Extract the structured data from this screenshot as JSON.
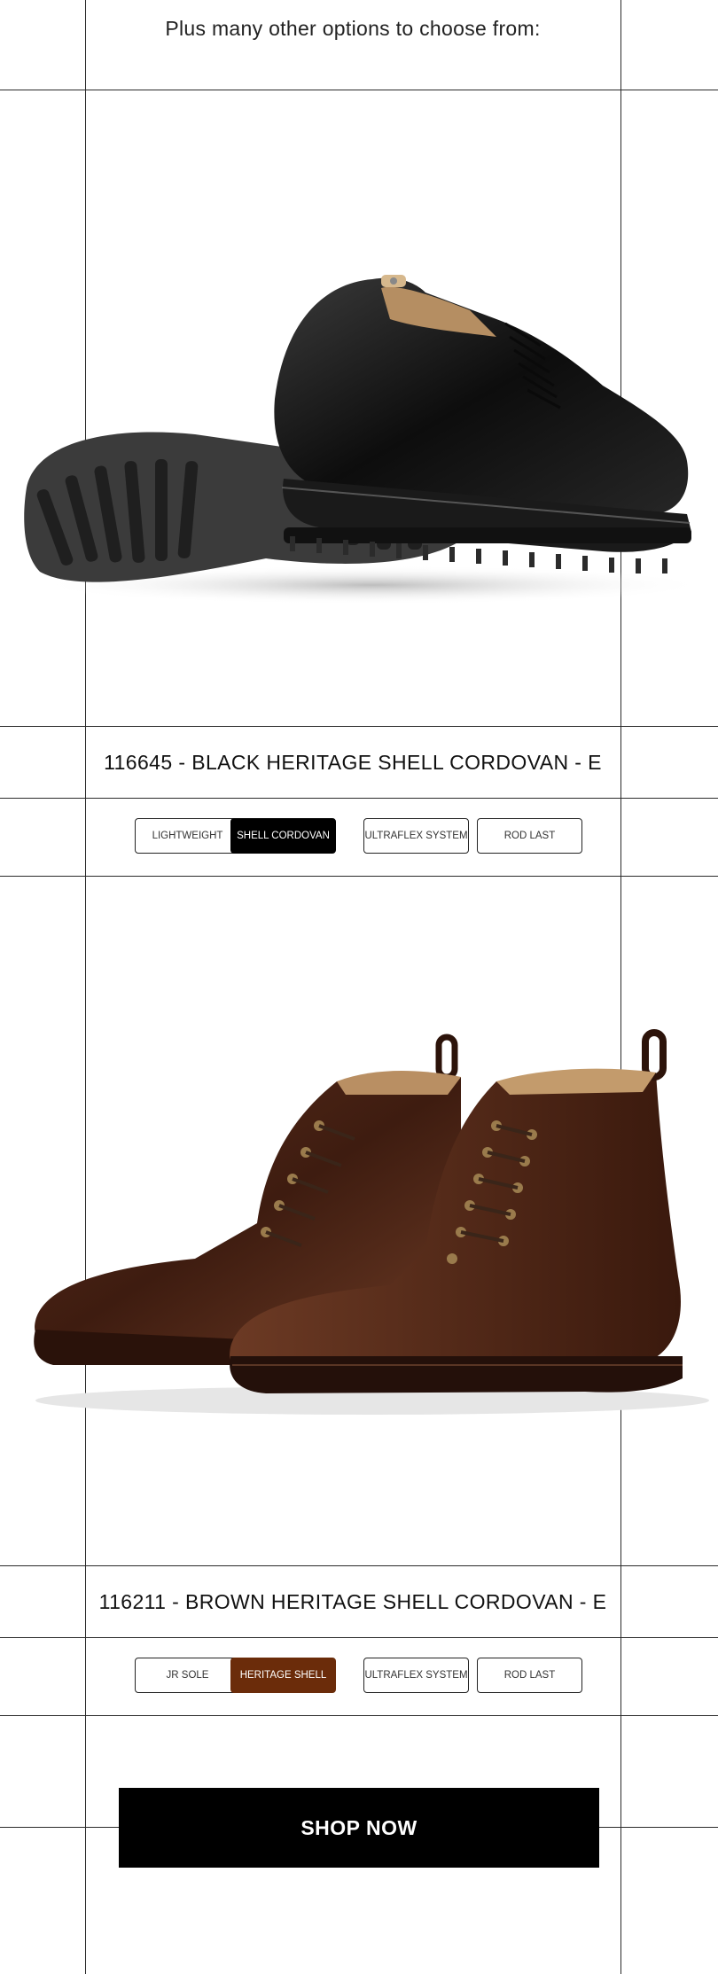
{
  "intro": {
    "heading": "Plus many other options to choose from:"
  },
  "products": [
    {
      "title": "116645 - BLACK HERITAGE SHELL CORDOVAN - E",
      "image_icon": "black-derby-shoe-photo",
      "tags": [
        "LIGHTWEIGHT",
        "SHELL CORDOVAN",
        "ULTRAFLEX SYSTEM",
        "ROD LAST"
      ],
      "active_tag": "SHELL CORDOVAN",
      "accent": "#000000"
    },
    {
      "title": "116211 - BROWN HERITAGE SHELL CORDOVAN - E",
      "image_icon": "brown-lace-up-boots-photo",
      "tags": [
        "JR SOLE",
        "HERITAGE SHELL",
        "ULTRAFLEX SYSTEM",
        "ROD LAST"
      ],
      "active_tag": "HERITAGE SHELL",
      "accent": "#6b2c0a"
    }
  ],
  "cta": {
    "label": "SHOP NOW"
  },
  "colors": {
    "grid": "#2a2a2a",
    "cta_bg": "#000000",
    "brown_accent": "#6b2c0a"
  }
}
